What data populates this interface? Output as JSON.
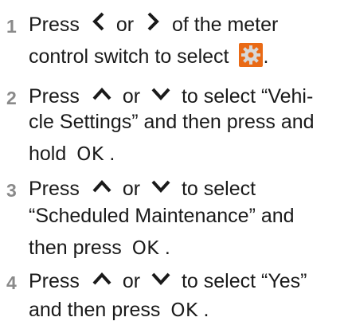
{
  "steps": [
    {
      "number": "1",
      "lines": [
        [
          "Press",
          "or",
          "of the meter"
        ],
        [
          "control switch to select",
          "."
        ]
      ],
      "icons": [
        "chevron-left-icon",
        "chevron-right-icon",
        "gear-settings-icon"
      ]
    },
    {
      "number": "2",
      "lines": [
        [
          "Press",
          "or",
          "to select “Vehi-"
        ],
        [
          "cle Settings” and then press and"
        ],
        [
          "hold",
          "OK",
          "."
        ]
      ],
      "icons": [
        "chevron-up-icon",
        "chevron-down-icon"
      ]
    },
    {
      "number": "3",
      "lines": [
        [
          "Press",
          "or",
          "to select"
        ],
        [
          "“Scheduled Maintenance” and"
        ],
        [
          "then press",
          "OK",
          "."
        ]
      ],
      "icons": [
        "chevron-up-icon",
        "chevron-down-icon"
      ]
    },
    {
      "number": "4",
      "lines": [
        [
          "Press",
          "or",
          "to select “Yes”"
        ],
        [
          "and then press",
          "OK",
          "."
        ]
      ],
      "icons": [
        "chevron-up-icon",
        "chevron-down-icon"
      ]
    }
  ],
  "colors": {
    "step_number": "#8a8a8a",
    "text": "#1a1a1a",
    "gear_background": "#e96a16"
  }
}
